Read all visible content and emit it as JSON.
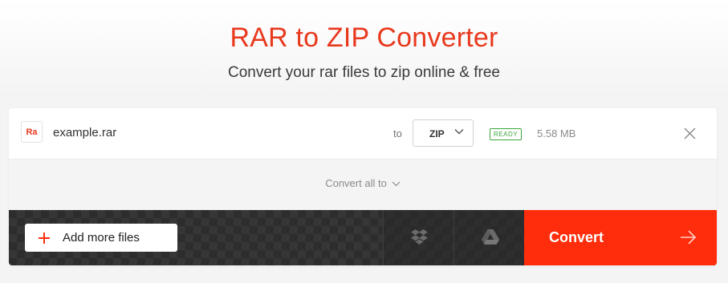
{
  "header": {
    "title": "RAR to ZIP Converter",
    "subtitle": "Convert your rar files to zip online & free"
  },
  "file": {
    "badge": "Ra",
    "name": "example.rar",
    "to_label": "to",
    "format": "ZIP",
    "status": "READY",
    "size": "5.58 MB"
  },
  "convert_all": {
    "label": "Convert all to"
  },
  "actions": {
    "add_files_label": "Add more files",
    "convert_label": "Convert"
  },
  "colors": {
    "brand": "#ff2d0b",
    "title": "#e8391d",
    "ready": "#3aa63a"
  },
  "icons": [
    "chevron-down-icon",
    "close-icon",
    "plus-icon",
    "dropbox-icon",
    "google-drive-icon",
    "arrow-right-icon"
  ]
}
